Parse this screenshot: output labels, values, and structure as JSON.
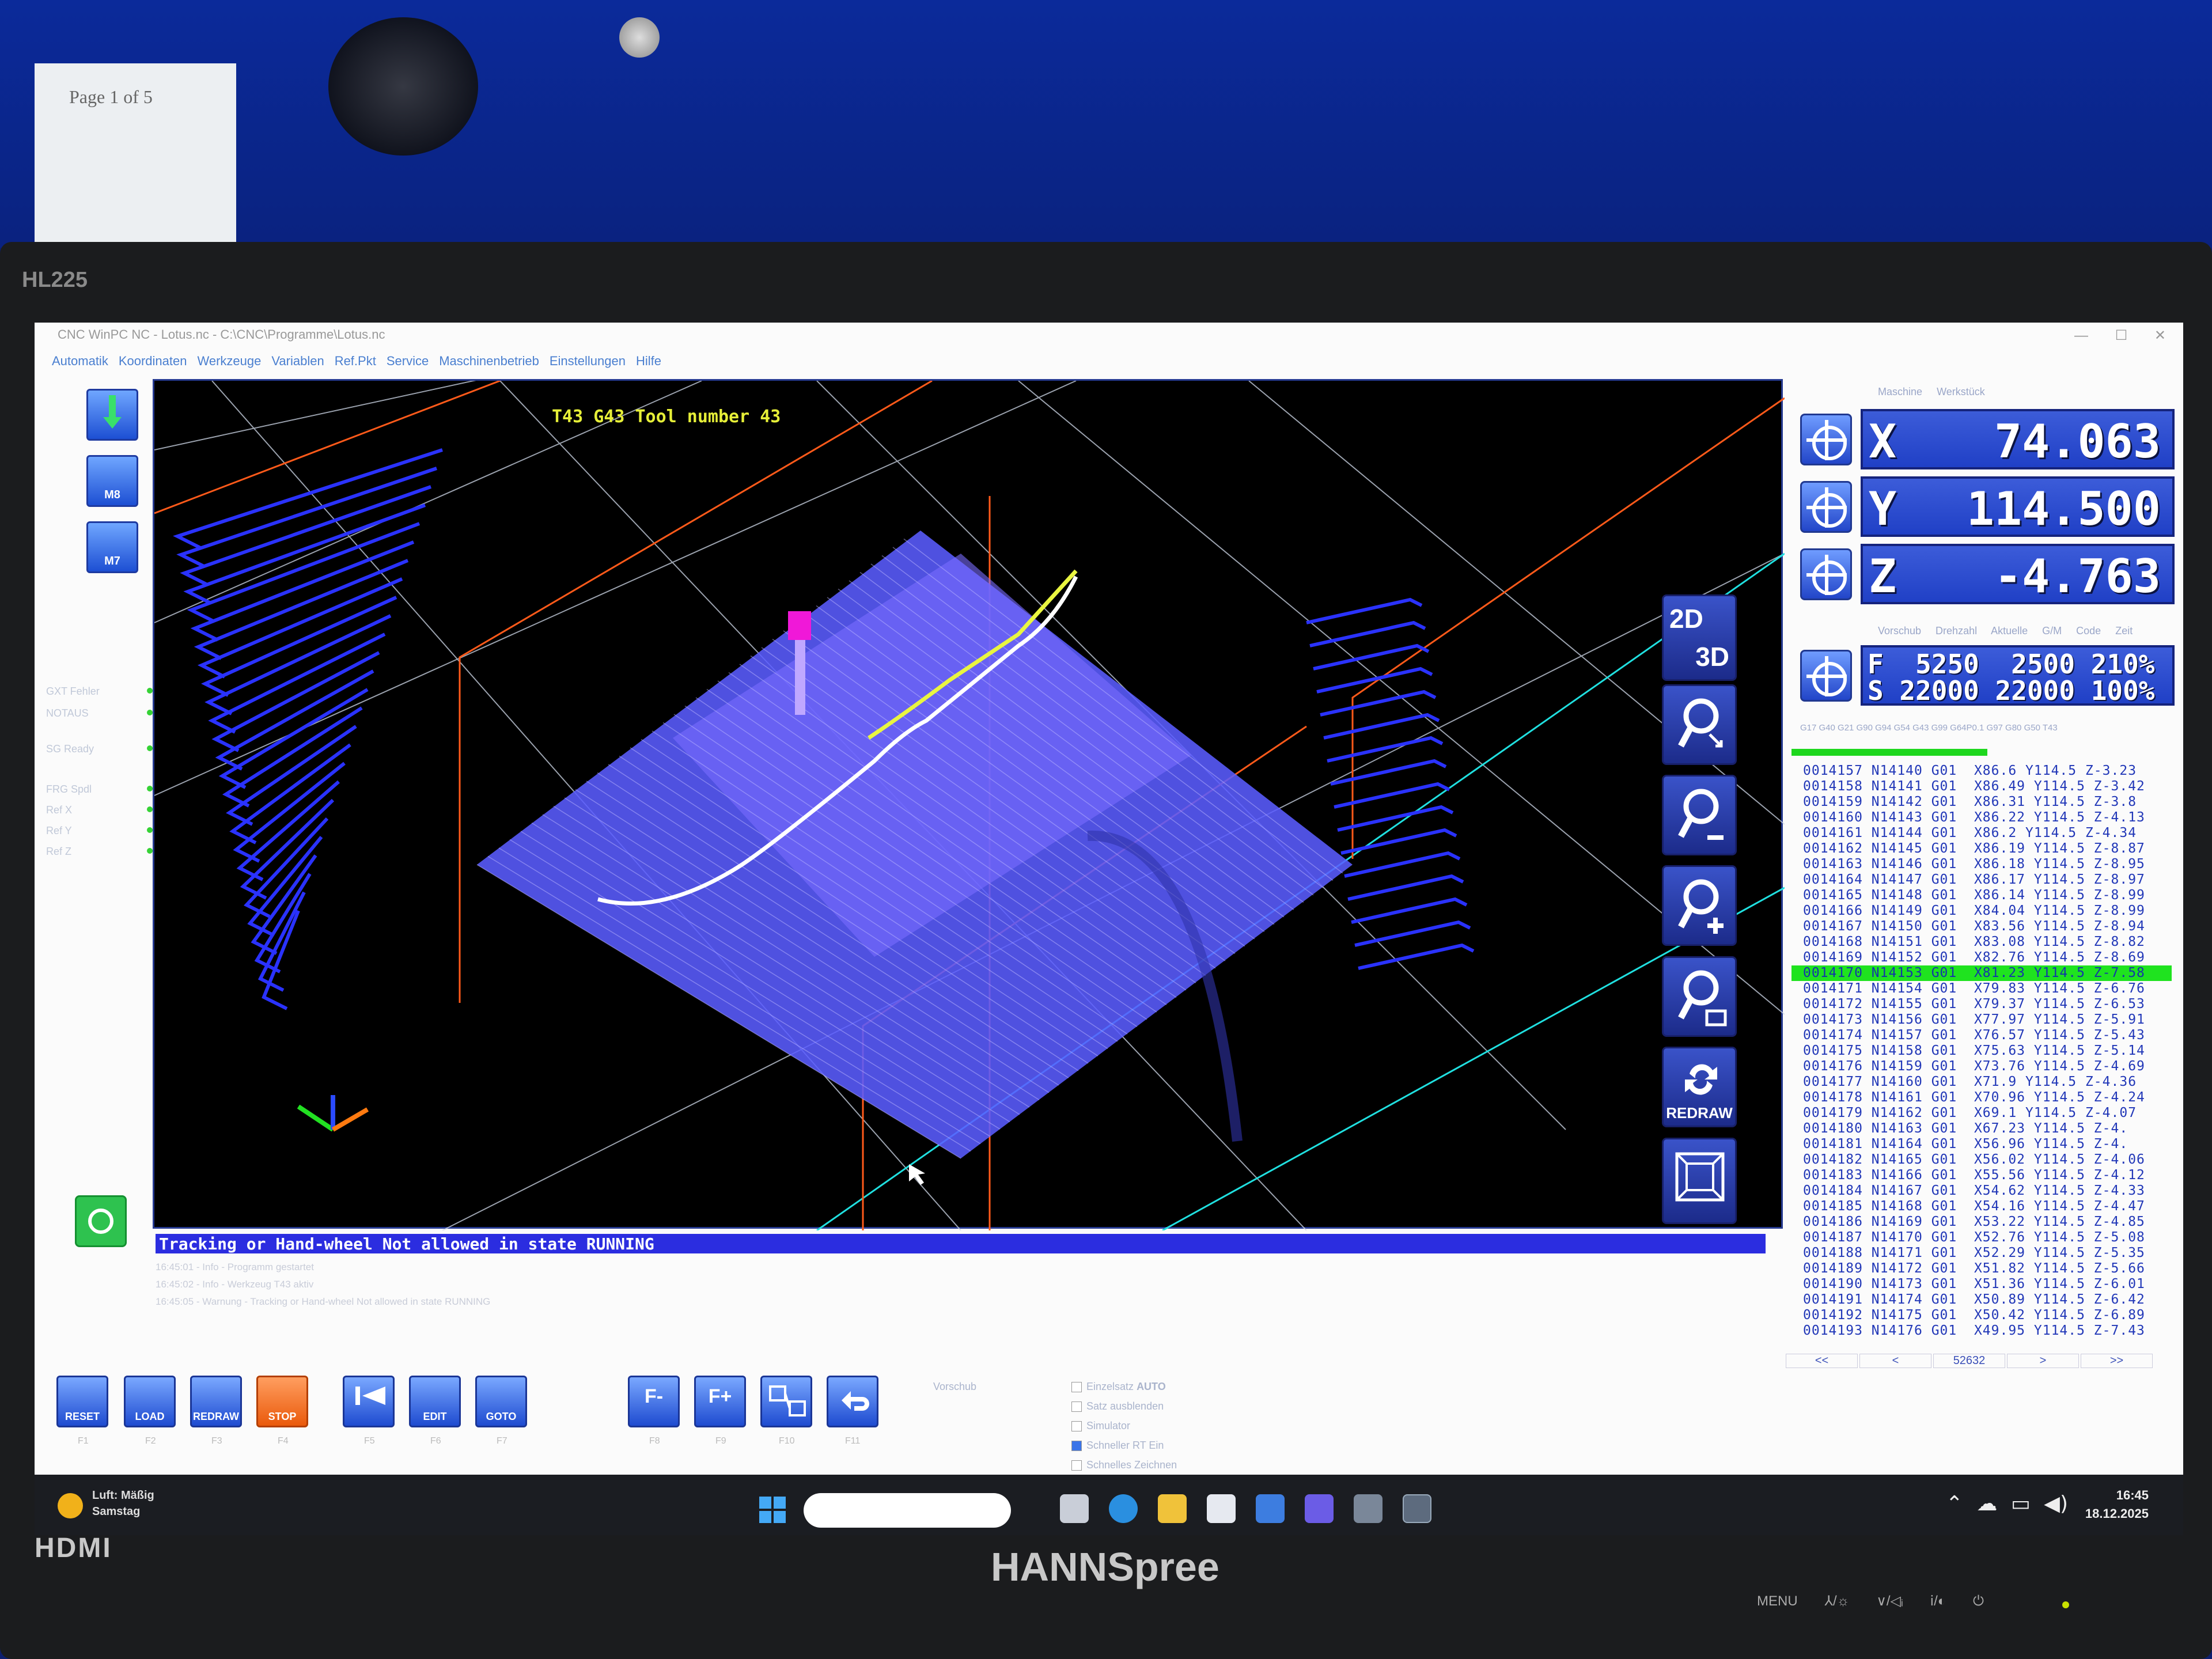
{
  "background": {
    "paper_text": "Page 1 of 5"
  },
  "monitor": {
    "model": "HL225",
    "hdmi": "HDMI",
    "brand": "HANNSpree",
    "buttons": "MENU ⅄/☼ ∨/◁ᵢ ⅰ/◐ ⏻"
  },
  "app": {
    "title": "CNC WinPC NC - Lotus.nc - C:\\CNC\\Programme\\Lotus.nc",
    "window_controls": "—  ☐  ✕",
    "menu": [
      "Automatik",
      "Koordinaten",
      "Werkzeuge",
      "Variablen",
      "Ref.Pkt",
      "Service",
      "Maschinenbetrieb",
      "Einstellungen",
      "Hilfe"
    ],
    "left_buttons": [
      {
        "label": "",
        "icon": "spindle-icon"
      },
      {
        "label": "M8",
        "icon": "coolant-icon"
      },
      {
        "label": "M7",
        "icon": "mist-icon"
      }
    ],
    "status_rows": [
      "GXT Fehler",
      "NOTAUS",
      "SG Ready",
      "FRG Spdl",
      "Ref X",
      "Ref Y",
      "Ref Z"
    ],
    "viewport": {
      "tool_text": "T43 G43 Tool number 43",
      "message": "Tracking or Hand-wheel Not allowed in state RUNNING",
      "log": [
        "16:45:01 - Info - Programm gestartet",
        "16:45:02 - Info - Werkzeug T43 aktiv",
        "16:45:05 - Warnung - Tracking or Hand-wheel Not allowed in state RUNNING"
      ]
    },
    "view_buttons": {
      "dim_2d": "2D",
      "dim_3d": "3D",
      "redraw": "REDRAW"
    },
    "right_tabs": [
      "Maschine",
      "Werkstück"
    ],
    "axes": [
      {
        "label": "X",
        "value": "74.063"
      },
      {
        "label": "Y",
        "value": "114.500"
      },
      {
        "label": "Z",
        "value": "-4.763"
      }
    ],
    "sub_tabs": [
      "Vorschub Drehzahl",
      "Aktuelle G/M Code",
      "Zeit"
    ],
    "feed": {
      "row_f": "F  5250  2500 210%",
      "row_s": "S 22000 22000 100%"
    },
    "active_gcodes": "G17 G40 G21 G90 G94 G54 G43 G99 G64P0.1 G97 G80 G50 T43",
    "code_lines": [
      "0014157 N14140 G01  X86.6 Y114.5 Z-3.23",
      "0014158 N14141 G01  X86.49 Y114.5 Z-3.42",
      "0014159 N14142 G01  X86.31 Y114.5 Z-3.8",
      "0014160 N14143 G01  X86.22 Y114.5 Z-4.13",
      "0014161 N14144 G01  X86.2 Y114.5 Z-4.34",
      "0014162 N14145 G01  X86.19 Y114.5 Z-8.87",
      "0014163 N14146 G01  X86.18 Y114.5 Z-8.95",
      "0014164 N14147 G01  X86.17 Y114.5 Z-8.97",
      "0014165 N14148 G01  X86.14 Y114.5 Z-8.99",
      "0014166 N14149 G01  X84.04 Y114.5 Z-8.99",
      "0014167 N14150 G01  X83.56 Y114.5 Z-8.94",
      "0014168 N14151 G01  X83.08 Y114.5 Z-8.82",
      "0014169 N14152 G01  X82.76 Y114.5 Z-8.69",
      "0014170 N14153 G01  X81.23 Y114.5 Z-7.58",
      "0014171 N14154 G01  X79.83 Y114.5 Z-6.76",
      "0014172 N14155 G01  X79.37 Y114.5 Z-6.53",
      "0014173 N14156 G01  X77.97 Y114.5 Z-5.91",
      "0014174 N14157 G01  X76.57 Y114.5 Z-5.43",
      "0014175 N14158 G01  X75.63 Y114.5 Z-5.14",
      "0014176 N14159 G01  X73.76 Y114.5 Z-4.69",
      "0014177 N14160 G01  X71.9 Y114.5 Z-4.36",
      "0014178 N14161 G01  X70.96 Y114.5 Z-4.24",
      "0014179 N14162 G01  X69.1 Y114.5 Z-4.07",
      "0014180 N14163 G01  X67.23 Y114.5 Z-4.",
      "0014181 N14164 G01  X56.96 Y114.5 Z-4.",
      "0014182 N14165 G01  X56.02 Y114.5 Z-4.06",
      "0014183 N14166 G01  X55.56 Y114.5 Z-4.12",
      "0014184 N14167 G01  X54.62 Y114.5 Z-4.33",
      "0014185 N14168 G01  X54.16 Y114.5 Z-4.47",
      "0014186 N14169 G01  X53.22 Y114.5 Z-4.85",
      "0014187 N14170 G01  X52.76 Y114.5 Z-5.08",
      "0014188 N14171 G01  X52.29 Y114.5 Z-5.35",
      "0014189 N14172 G01  X51.82 Y114.5 Z-5.66",
      "0014190 N14173 G01  X51.36 Y114.5 Z-6.01",
      "0014191 N14174 G01  X50.89 Y114.5 Z-6.42",
      "0014192 N14175 G01  X50.42 Y114.5 Z-6.89",
      "0014193 N14176 G01  X49.95 Y114.5 Z-7.43"
    ],
    "current_line_index": 13,
    "code_nav": [
      "<<",
      "<",
      "52632",
      ">",
      ">>"
    ],
    "toolbar": [
      {
        "label": "RESET",
        "sub": "F1"
      },
      {
        "label": "LOAD",
        "sub": "F2"
      },
      {
        "label": "REDRAW",
        "sub": "F3"
      },
      {
        "label": "STOP",
        "sub": "F4"
      },
      {
        "label": "",
        "sub": "F5"
      },
      {
        "label": "EDIT",
        "sub": "F6"
      },
      {
        "label": "GOTO",
        "sub": "F7"
      },
      {
        "label": "F-",
        "sub": "F8"
      },
      {
        "label": "F+",
        "sub": "F9"
      },
      {
        "label": "",
        "sub": "F10"
      },
      {
        "label": "",
        "sub": "F11"
      }
    ],
    "options": {
      "feed_label": "Vorschub",
      "items": [
        "Einzelsatz",
        "Satz ausblenden",
        "Simulator",
        "Schneller RT Ein",
        "Schnelles Zeichnen"
      ],
      "auto_label": "AUTO",
      "checked": [
        false,
        false,
        false,
        true,
        false
      ]
    }
  },
  "taskbar": {
    "weather_line1": "Luft: Mäßig",
    "weather_line2": "Samstag",
    "time": "16:45",
    "date": "18.12.2025"
  }
}
